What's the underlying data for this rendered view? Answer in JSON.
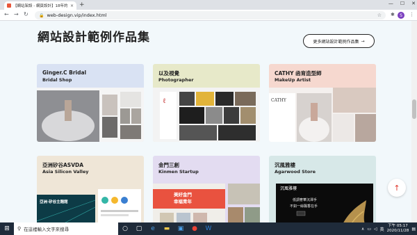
{
  "browser": {
    "tab_title": "【網站架設 - 網頁設計】18年的",
    "tab_close": "×",
    "new_tab": "+",
    "url": "web-design.vip/index.html",
    "back": "←",
    "forward": "→",
    "reload": "↻",
    "profile_initial": "S",
    "win_min": "—",
    "win_max": "☐",
    "win_close": "✕"
  },
  "page": {
    "heading": "網站設計範例作品集",
    "more_button": "更多網站設計範例作品集",
    "more_arrow": "→",
    "cards": [
      {
        "title": "Ginger.C Bridal",
        "subtitle": "Bridal Shop",
        "bg": "#d9e2f3"
      },
      {
        "title": "以及視覺",
        "subtitle": "Photographer",
        "bg": "#e7e9c9"
      },
      {
        "title": "CATHY 函育造型師",
        "subtitle": "MakeUp Artist",
        "bg": "#f6d8cf"
      },
      {
        "title": "亞洲矽谷ASVDA",
        "subtitle": "Asia Silicon Valley",
        "bg": "#efe6d7"
      },
      {
        "title": "金門三創",
        "subtitle": "Kinmen Startup",
        "bg": "#e3dcf1"
      },
      {
        "title": "沉風雅樓",
        "subtitle": "Agarwood Store",
        "bg": "#d7e8e8"
      }
    ],
    "card4_banner": "亞洲·矽谷主題館",
    "card5_banner_1": "美好金門",
    "card5_banner_2": "幸福青年",
    "card6_logo": "沉風雅樓",
    "card6_line1": "低調奢華沉澤手",
    "card6_line2": "不如一絲飄香在手",
    "scroll_top": "↑"
  },
  "taskbar": {
    "search_placeholder": "在這裡輸入文字來搜尋",
    "ime": "英",
    "time": "下午 05:17",
    "date": "2020/11/28"
  }
}
